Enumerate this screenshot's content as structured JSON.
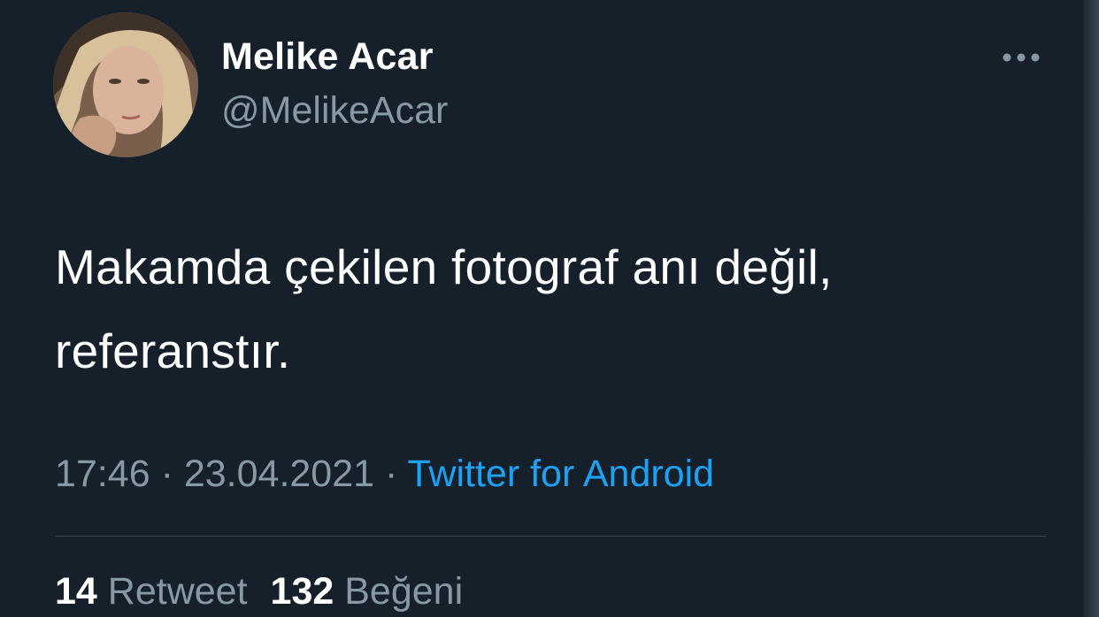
{
  "tweet": {
    "author": {
      "display_name": "Melike Acar",
      "handle": "@MelikeAcar"
    },
    "text_lines": [
      "Makamda çekilen fotograf anı değil,",
      "referanstır."
    ],
    "time": "17:46",
    "date": "23.04.2021",
    "separator": "·",
    "source": "Twitter for Android",
    "stats": {
      "retweets_count": "14",
      "retweets_label": "Retweet",
      "likes_count": "132",
      "likes_label": "Beğeni"
    }
  },
  "icons": {
    "more": "more-options-icon"
  },
  "colors": {
    "background": "#15202b",
    "primary_text": "#ffffff",
    "secondary_text": "#8899a6",
    "link": "#1da1f2",
    "divider": "#38444d"
  }
}
